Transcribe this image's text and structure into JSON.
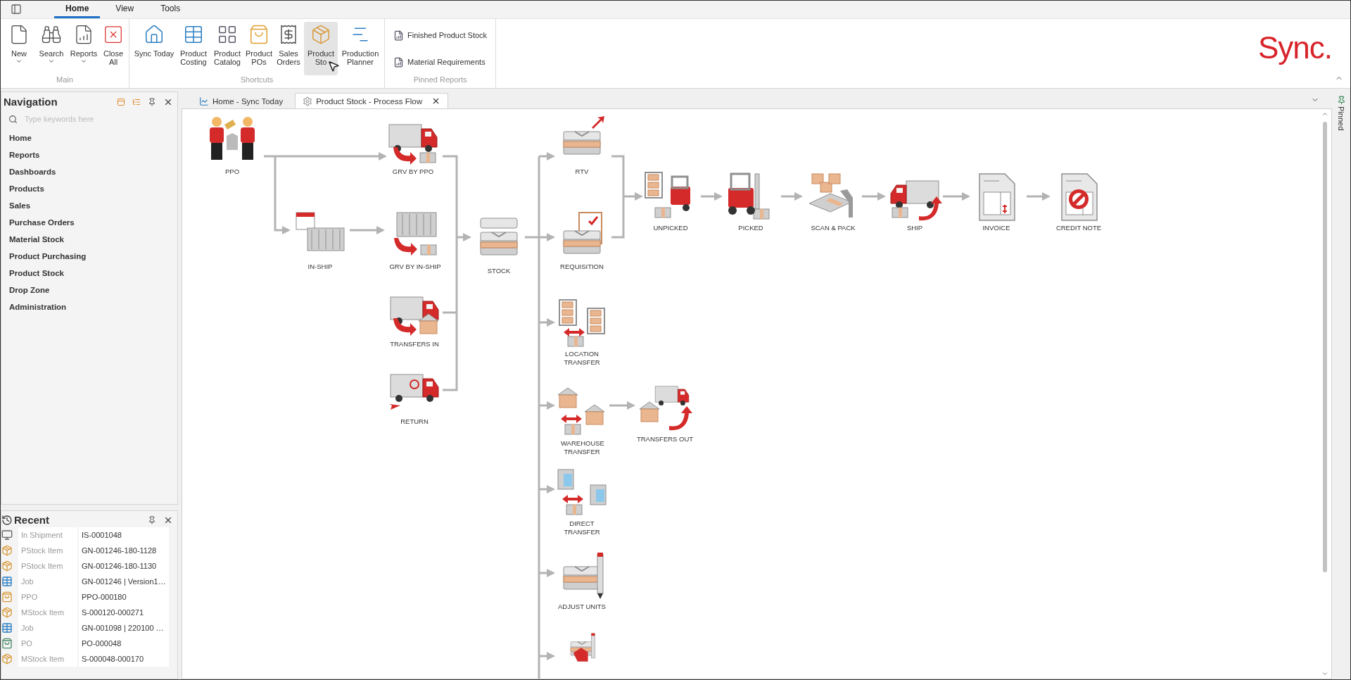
{
  "ribbon_tabs": [
    {
      "label": "Home",
      "selected": true
    },
    {
      "label": "View",
      "selected": false
    },
    {
      "label": "Tools",
      "selected": false
    }
  ],
  "ribbon_groups": {
    "main": {
      "title": "Main",
      "buttons": [
        {
          "label": "New",
          "has_menu": true
        },
        {
          "label": "Search",
          "has_menu": true
        },
        {
          "label": "Reports",
          "has_menu": true
        },
        {
          "label": "Close All",
          "has_menu": false
        }
      ]
    },
    "shortcuts": {
      "title": "Shortcuts",
      "buttons": [
        {
          "label": "Sync Today",
          "hovered": false
        },
        {
          "label": "Product Costing",
          "hovered": false
        },
        {
          "label": "Product Catalog",
          "hovered": false
        },
        {
          "label": "Product POs",
          "hovered": false
        },
        {
          "label": "Sales Orders",
          "hovered": false
        },
        {
          "label": "Product Sto",
          "hovered": true
        },
        {
          "label": "Production Planner",
          "hovered": false
        }
      ]
    },
    "pinned_reports": {
      "title": "Pinned Reports",
      "items": [
        "Finished Product Stock",
        "Material Requirements"
      ]
    }
  },
  "logo": "Sync.",
  "navigation": {
    "title": "Navigation",
    "search": {
      "placeholder": "Type keywords here"
    },
    "items": [
      "Home",
      "Reports",
      "Dashboards",
      "Products",
      "Sales",
      "Purchase Orders",
      "Material Stock",
      "Product Purchasing",
      "Product Stock",
      "Drop Zone",
      "Administration"
    ]
  },
  "recent": {
    "title": "Recent",
    "rows": [
      {
        "type": "In Shipment",
        "value": "IS-0001048"
      },
      {
        "type": "PStock Item",
        "value": "GN-001246-180-1128"
      },
      {
        "type": "PStock Item",
        "value": "GN-001246-180-1130"
      },
      {
        "type": "Job",
        "value": "GN-001246 | Version1…"
      },
      {
        "type": "PPO",
        "value": "PPO-000180"
      },
      {
        "type": "MStock Item",
        "value": "S-000120-000271"
      },
      {
        "type": "Job",
        "value": "GN-001098 | 220100 …"
      },
      {
        "type": "PO",
        "value": "PO-000048"
      },
      {
        "type": "MStock Item",
        "value": "S-000048-000170"
      }
    ]
  },
  "document_tabs": [
    {
      "label": "Home - Sync Today",
      "selected": false
    },
    {
      "label": "Product Stock - Process Flow",
      "selected": true
    }
  ],
  "process_flow": {
    "nodes": [
      {
        "label": "PPO"
      },
      {
        "label": "GRV BY PPO"
      },
      {
        "label": "IN-SHIP"
      },
      {
        "label": "GRV BY IN-SHIP"
      },
      {
        "label": "TRANSFERS IN"
      },
      {
        "label": "RETURN"
      },
      {
        "label": "STOCK"
      },
      {
        "label": "RTV"
      },
      {
        "label": "REQUISITION"
      },
      {
        "label": "LOCATION TRANSFER"
      },
      {
        "label": "WAREHOUSE TRANSFER"
      },
      {
        "label": "TRANSFERS OUT"
      },
      {
        "label": "DIRECT TRANSFER"
      },
      {
        "label": "ADJUST UNITS"
      },
      {
        "clipped": true
      },
      {
        "label": "UNPICKED"
      },
      {
        "label": "PICKED"
      },
      {
        "label": "SCAN & PACK"
      },
      {
        "label": "SHIP"
      },
      {
        "label": "INVOICE"
      },
      {
        "label": "CREDIT NOTE"
      }
    ]
  },
  "pinned_strip": {
    "label": "Pinned"
  }
}
